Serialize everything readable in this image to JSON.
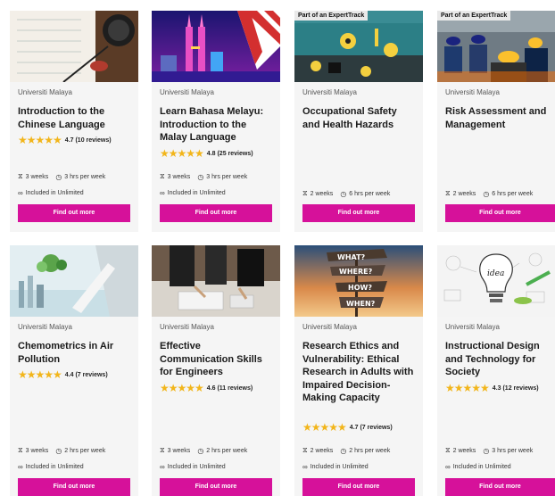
{
  "cards": [
    {
      "university": "Universiti Malaya",
      "title": "Introduction to the Chinese Language",
      "rating": "4.7 (10 reviews)",
      "stars": "★★★★★",
      "duration": "3 weeks",
      "effort": "3 hrs per week",
      "unlimited": "Included in Unlimited",
      "cta": "Find out more"
    },
    {
      "university": "Universiti Malaya",
      "title": "Learn Bahasa Melayu: Introduction to the Malay Language",
      "rating": "4.8 (25 reviews)",
      "stars": "★★★★★",
      "duration": "3 weeks",
      "effort": "3 hrs per week",
      "unlimited": "Included in Unlimited",
      "cta": "Find out more"
    },
    {
      "badge": "Part of an ExpertTrack",
      "university": "Universiti Malaya",
      "title": "Occupational Safety and Health Hazards",
      "duration": "2 weeks",
      "effort": "6 hrs per week",
      "cta": "Find out more"
    },
    {
      "badge": "Part of an ExpertTrack",
      "university": "Universiti Malaya",
      "title": "Risk Assessment and Management",
      "duration": "2 weeks",
      "effort": "6 hrs per week",
      "cta": "Find out more"
    },
    {
      "university": "Universiti Malaya",
      "title": "Chemometrics in Air Pollution",
      "rating": "4.4 (7 reviews)",
      "stars": "★★★★★",
      "duration": "3 weeks",
      "effort": "2 hrs per week",
      "unlimited": "Included in Unlimited",
      "cta": "Find out more"
    },
    {
      "university": "Universiti Malaya",
      "title": "Effective Communication Skills for Engineers",
      "rating": "4.6 (11 reviews)",
      "stars": "★★★★★",
      "duration": "3 weeks",
      "effort": "2 hrs per week",
      "unlimited": "Included in Unlimited",
      "cta": "Find out more"
    },
    {
      "university": "Universiti Malaya",
      "title": "Research Ethics and Vulnerability: Ethical Research in Adults with Impaired Decision-Making Capacity",
      "rating": "4.7 (7 reviews)",
      "stars": "★★★★★",
      "duration": "2 weeks",
      "effort": "2 hrs per week",
      "unlimited": "Included in Unlimited",
      "cta": "Find out more"
    },
    {
      "university": "Universiti Malaya",
      "title": "Instructional Design and Technology for Society",
      "rating": "4.3 (12 reviews)",
      "stars": "★★★★★",
      "duration": "2 weeks",
      "effort": "3 hrs per week",
      "unlimited": "Included in Unlimited",
      "cta": "Find out more"
    }
  ],
  "signpost_text": [
    "WHAT?",
    "WHERE?",
    "HOW?",
    "WHEN?"
  ],
  "idea_text": "idea",
  "colors": {
    "cta": "#d6119a",
    "star": "#f2b51a",
    "card_bg": "#f5f5f5"
  },
  "icons": {
    "duration": "hourglass-icon",
    "effort": "clock-icon",
    "unlimited": "infinity-icon"
  }
}
